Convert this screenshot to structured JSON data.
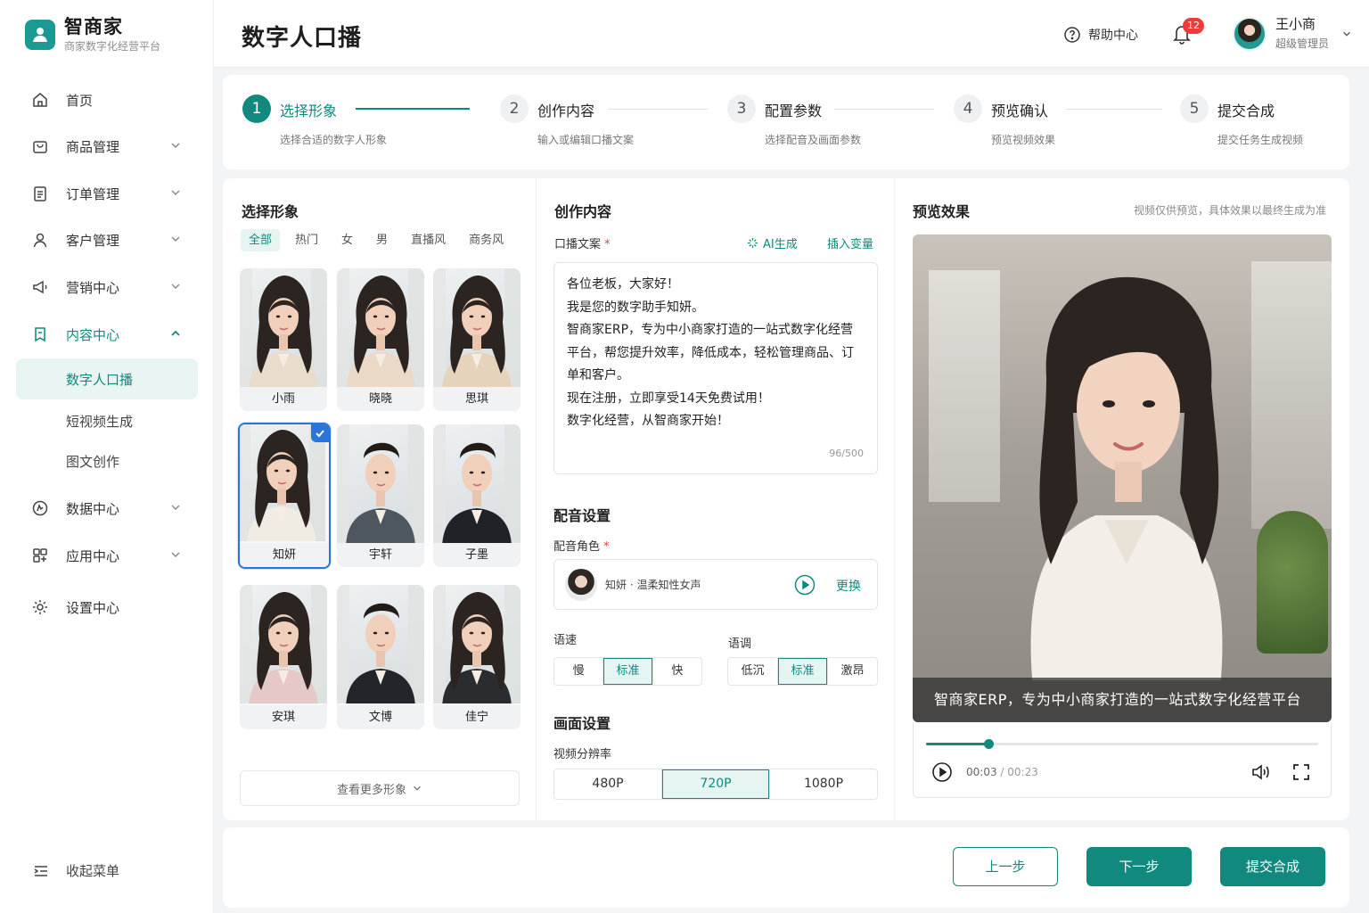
{
  "brand": {
    "name": "智商家",
    "subtitle": "商家数字化经营平台"
  },
  "sidebar": {
    "items": [
      {
        "label": "首页",
        "icon": "home-icon"
      },
      {
        "label": "商品管理",
        "icon": "bag-icon"
      },
      {
        "label": "订单管理",
        "icon": "document-icon"
      },
      {
        "label": "客户管理",
        "icon": "user-icon"
      },
      {
        "label": "营销中心",
        "icon": "megaphone-icon"
      },
      {
        "label": "内容中心",
        "icon": "bookmark-icon",
        "expanded": true
      },
      {
        "label": "数据中心",
        "icon": "chart-icon"
      },
      {
        "label": "应用中心",
        "icon": "apps-icon"
      },
      {
        "label": "设置中心",
        "icon": "gear-icon"
      }
    ],
    "sub_items": [
      "数字人口播",
      "短视频生成",
      "图文创作"
    ],
    "active_sub": "数字人口播",
    "collapse_label": "收起菜单"
  },
  "header": {
    "title": "数字人口播",
    "help_label": "帮助中心",
    "notification_count": "12",
    "user_name": "王小商",
    "user_role": "超级管理员"
  },
  "steps": [
    {
      "num": "1",
      "label": "选择形象",
      "desc": "选择合适的数字人形象",
      "active": true
    },
    {
      "num": "2",
      "label": "创作内容",
      "desc": "输入或编辑口播文案"
    },
    {
      "num": "3",
      "label": "配置参数",
      "desc": "选择配音及画面参数"
    },
    {
      "num": "4",
      "label": "预览确认",
      "desc": "预览视频效果"
    },
    {
      "num": "5",
      "label": "提交合成",
      "desc": "提交任务生成视频"
    }
  ],
  "avatars": {
    "title": "选择形象",
    "filters": [
      "全部",
      "热门",
      "女",
      "男",
      "直播风",
      "商务风"
    ],
    "active_filter": "全部",
    "list": [
      {
        "name": "小雨",
        "gender": "female",
        "outfit": "#e8dccc"
      },
      {
        "name": "晓晓",
        "gender": "female",
        "outfit": "#ead9c7"
      },
      {
        "name": "思琪",
        "gender": "female",
        "outfit": "#e5d3bb"
      },
      {
        "name": "知妍",
        "gender": "female",
        "outfit": "#f1ece3",
        "selected": true
      },
      {
        "name": "宇轩",
        "gender": "male",
        "outfit": "#4e5660"
      },
      {
        "name": "子墨",
        "gender": "male",
        "outfit": "#1f2226"
      },
      {
        "name": "安琪",
        "gender": "female",
        "outfit": "#e6c9c6"
      },
      {
        "name": "文博",
        "gender": "male",
        "outfit": "#22262b"
      },
      {
        "name": "佳宁",
        "gender": "female",
        "outfit": "#2a2c2f"
      }
    ],
    "more_label": "查看更多形象"
  },
  "content": {
    "title": "创作内容",
    "script_label": "口播文案",
    "ai_label": "AI生成",
    "insert_label": "插入变量",
    "script_lines": [
      "各位老板，大家好！",
      "我是您的数字助手知妍。",
      "智商家ERP，专为中小商家打造的一站式数字化经营",
      "平台，帮您提升效率，降低成本，轻松管理商品、订",
      "单和客户。",
      "现在注册，立即享受14天免费试用！",
      "数字化经营，从智商家开始！"
    ],
    "char_count": "96/500",
    "voice_title": "配音设置",
    "voice_role_label": "配音角色",
    "voice_name": "知妍 · 温柔知性女声",
    "voice_change": "更换",
    "speed_label": "语速",
    "speed_options": [
      "慢",
      "标准",
      "快"
    ],
    "speed_value": "标准",
    "tone_label": "语调",
    "tone_options": [
      "低沉",
      "标准",
      "激昂"
    ],
    "tone_value": "标准",
    "screen_title": "画面设置",
    "resolution_label": "视频分辨率",
    "resolution_options": [
      "480P",
      "720P",
      "1080P"
    ],
    "resolution_value": "720P"
  },
  "preview": {
    "title": "预览效果",
    "note": "视频仅供预览，具体效果以最终生成为准",
    "caption": "智商家ERP，专为中小商家打造的一站式数字化经营平台",
    "current_time": "00:03",
    "total_time": "00:23",
    "progress": 0.16
  },
  "footer": {
    "prev": "上一步",
    "next": "下一步",
    "submit": "提交合成"
  },
  "colors": {
    "accent": "#12897f",
    "selected_border": "#2b74d8",
    "badge": "#ef3b3b"
  }
}
